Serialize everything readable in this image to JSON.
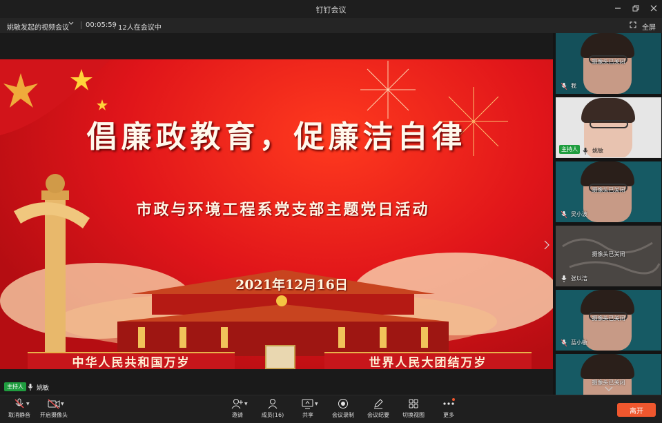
{
  "window": {
    "title": "钉钉会议",
    "minimize_icon": "minimize-icon",
    "maximize_icon": "restore-icon",
    "close_icon": "close-icon"
  },
  "info_bar": {
    "meeting_name": "姚敏发起的视频会议",
    "elapsed_time": "00:05:59",
    "participant_status": "12人在会议中",
    "fullscreen_label": "全屏"
  },
  "slide": {
    "headline": "倡廉政教育，促廉洁自律",
    "subline": "市政与环境工程系党支部主题党日活动",
    "date": "2021年12月16日",
    "banner_left": "中华人民共和国万岁",
    "banner_right": "世界人民大团结万岁"
  },
  "stage_speaker": {
    "host_badge": "主持人",
    "name": "姚敏"
  },
  "participants": [
    {
      "status": "摄像头已关闭",
      "name": "我",
      "host": ""
    },
    {
      "status": "",
      "name": "姚敏",
      "host": "主持人"
    },
    {
      "status": "摄像头已关闭",
      "name": "吴小波",
      "host": ""
    },
    {
      "status": "摄像头已关闭",
      "name": "张以洁",
      "host": ""
    },
    {
      "status": "摄像头已关闭",
      "name": "蓝小敏",
      "host": ""
    },
    {
      "status": "摄像头已关闭",
      "name": "",
      "host": ""
    }
  ],
  "toolbar": {
    "unmute": "取消静音",
    "camera": "开启摄像头",
    "invite": "邀请",
    "members": "成员(16)",
    "share": "共享",
    "record": "会议录制",
    "minutes": "会议纪要",
    "switch_view": "切换视图",
    "more": "更多",
    "leave": "离开"
  },
  "colors": {
    "accent_orange": "#f0572e",
    "host_green": "#1f9d3f",
    "slide_red": "#e0151a"
  }
}
